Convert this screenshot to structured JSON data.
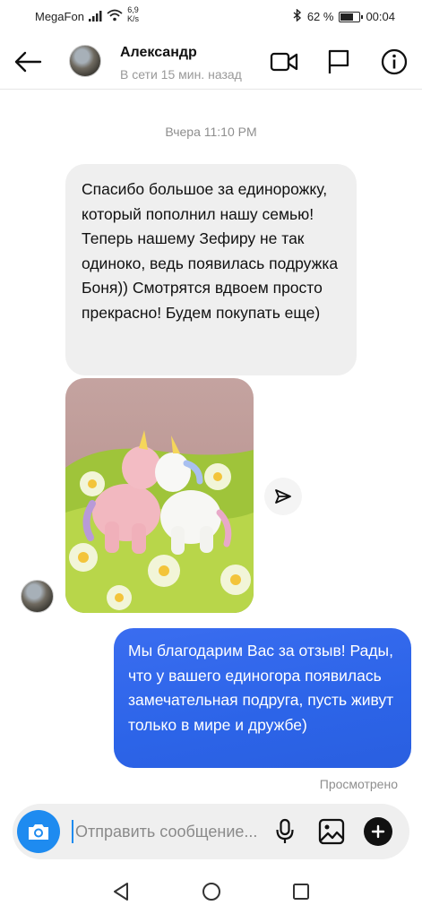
{
  "status_bar": {
    "carrier": "MegaFon",
    "speed_value": "6,9",
    "speed_unit": "K/s",
    "battery": "62 %",
    "battery_level": 0.62,
    "time": "00:04"
  },
  "header": {
    "contact_name": "Александр",
    "presence": "В сети 15 мин. назад"
  },
  "conversation": {
    "timestamp": "Вчера 11:10 PM",
    "incoming_message": "Спасибо большое за единорожку, который пополнил нашу семью! Теперь нашему Зефиру не так одиноко, ведь появилась подружка Боня)) Смотрятся вдвоем просто прекрасно! Будем покупать еще)",
    "outgoing_message": "Мы благодарим Вас за отзыв! Рады, что у вашего единогора появилась замечательная подруга, пусть живут только в мире и дружбе)",
    "seen_label": "Просмотрено"
  },
  "composer": {
    "placeholder": "Отправить сообщение..."
  },
  "icons": {
    "back": "arrow-left-icon",
    "video": "video-camera-icon",
    "flag": "flag-icon",
    "info": "info-icon",
    "share": "send-icon",
    "camera": "camera-icon",
    "mic": "microphone-icon",
    "gallery": "image-icon",
    "plus": "plus-icon",
    "nav_back": "triangle-back-icon",
    "nav_home": "circle-home-icon",
    "nav_recent": "square-recent-icon"
  },
  "colors": {
    "outgoing_bubble": "#2c64e8",
    "incoming_bubble": "#efefef",
    "camera_button": "#1e8bf0",
    "muted_text": "#8e8e8e"
  }
}
